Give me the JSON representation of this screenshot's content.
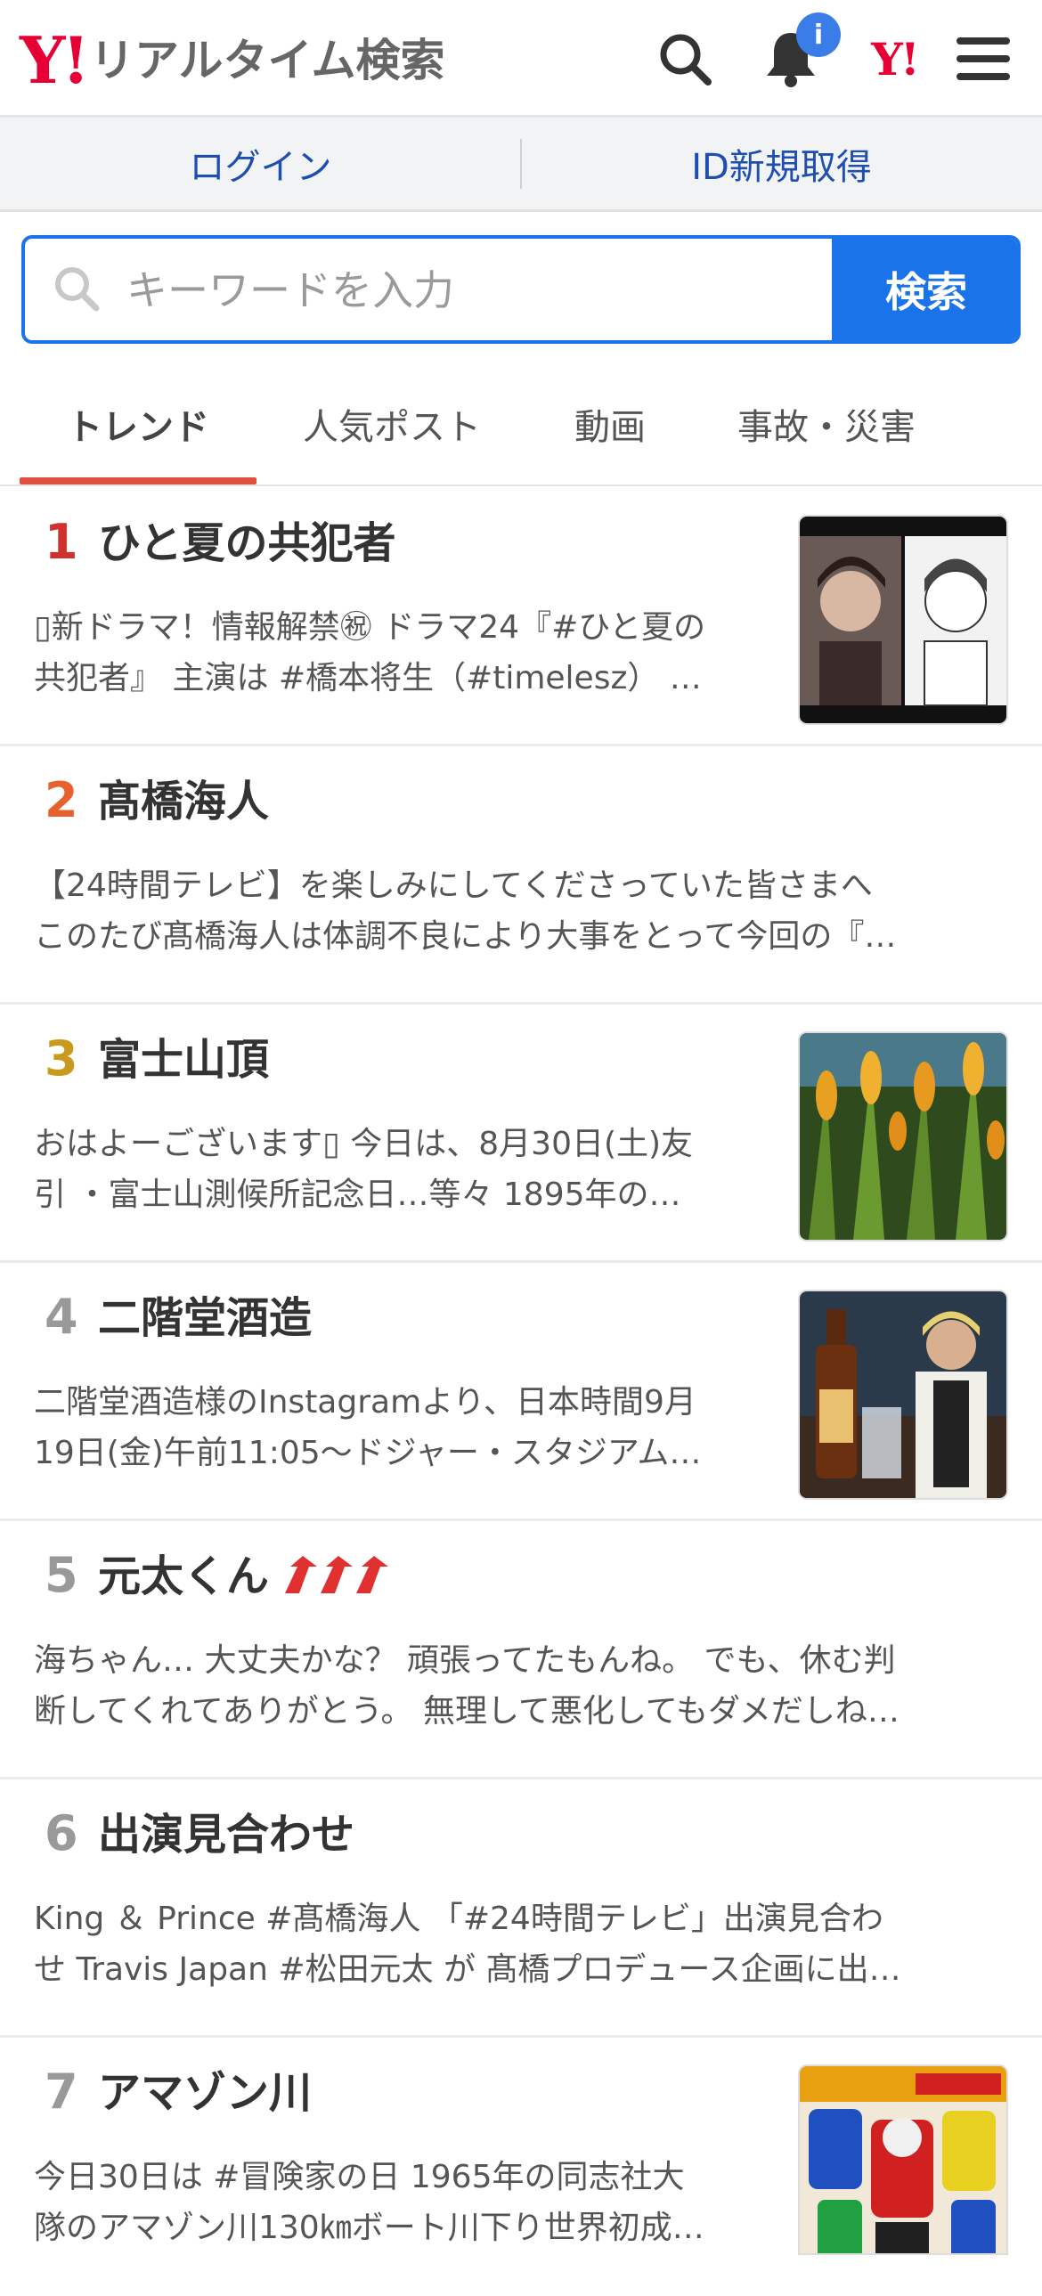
{
  "header": {
    "logo_y": "Y!",
    "logo_text": "リアルタイム検索",
    "notification_badge": "i",
    "yahoo_link": "Y!",
    "icons": [
      "search-icon",
      "bell-icon",
      "yahoo-icon",
      "menu-icon"
    ]
  },
  "loginbar": {
    "login": "ログイン",
    "signup": "ID新規取得"
  },
  "search": {
    "placeholder": "キーワードを入力",
    "button": "検索"
  },
  "tabs": [
    {
      "label": "トレンド",
      "active": true
    },
    {
      "label": "人気ポスト",
      "active": false
    },
    {
      "label": "動画",
      "active": false
    },
    {
      "label": "事故・災害",
      "active": false
    }
  ],
  "colors": {
    "accent_blue": "#1a73e8",
    "rank1": "#d0312d",
    "rank2": "#e8602c",
    "rank3": "#c99a1e",
    "rank_other": "#999999",
    "tab_underline": "#e05040",
    "trend_arrows": "#e03030"
  },
  "trends": [
    {
      "rank": "1",
      "title": "ひと夏の共犯者",
      "line1": "▯新ドラマ！情報解禁㊗ ドラマ24『#ひと夏の",
      "line2": "共犯者』 主演は #橋本将生（#timelesz） …",
      "thumb": "drama-poster"
    },
    {
      "rank": "2",
      "title": "髙橋海人",
      "line1": "【24時間テレビ】を楽しみにしてくださっていた皆さまへ",
      "line2": "このたび髙橋海人は体調不良により大事をとって今回の『…",
      "thumb": ""
    },
    {
      "rank": "3",
      "title": "富士山頂",
      "line1": "おはよーございます▯ 今日は、8月30日(土)友",
      "line2": "引 ・富士山測候所記念日…等々 1895年の…",
      "thumb": "flowers"
    },
    {
      "rank": "4",
      "title": "二階堂酒造",
      "line1": "二階堂酒造様のInstagramより、日本時間9月",
      "line2": "19日(金)午前11:05〜ドジャー・スタジアム…",
      "thumb": "bottle"
    },
    {
      "rank": "5",
      "title": "元太くん",
      "line1": "海ちゃん… 大丈夫かな？ 頑張ってたもんね。 でも、休む判",
      "line2": "断してくれてありがとう。 無理して悪化してもダメだしね…",
      "thumb": "",
      "trend_arrows": 3
    },
    {
      "rank": "6",
      "title": "出演見合わせ",
      "line1": "King ＆ Prince #髙橋海人 「#24時間テレビ」出演見合わ",
      "line2": "せ Travis Japan #松田元太 が 髙橋プロデュース企画に出…",
      "thumb": ""
    },
    {
      "rank": "7",
      "title": "アマゾン川",
      "line1": "今日30日は #冒険家の日 1965年の同志社大",
      "line2": "隊のアマゾン川130㎞ボート川下り世界初成…",
      "thumb": "comic"
    }
  ]
}
